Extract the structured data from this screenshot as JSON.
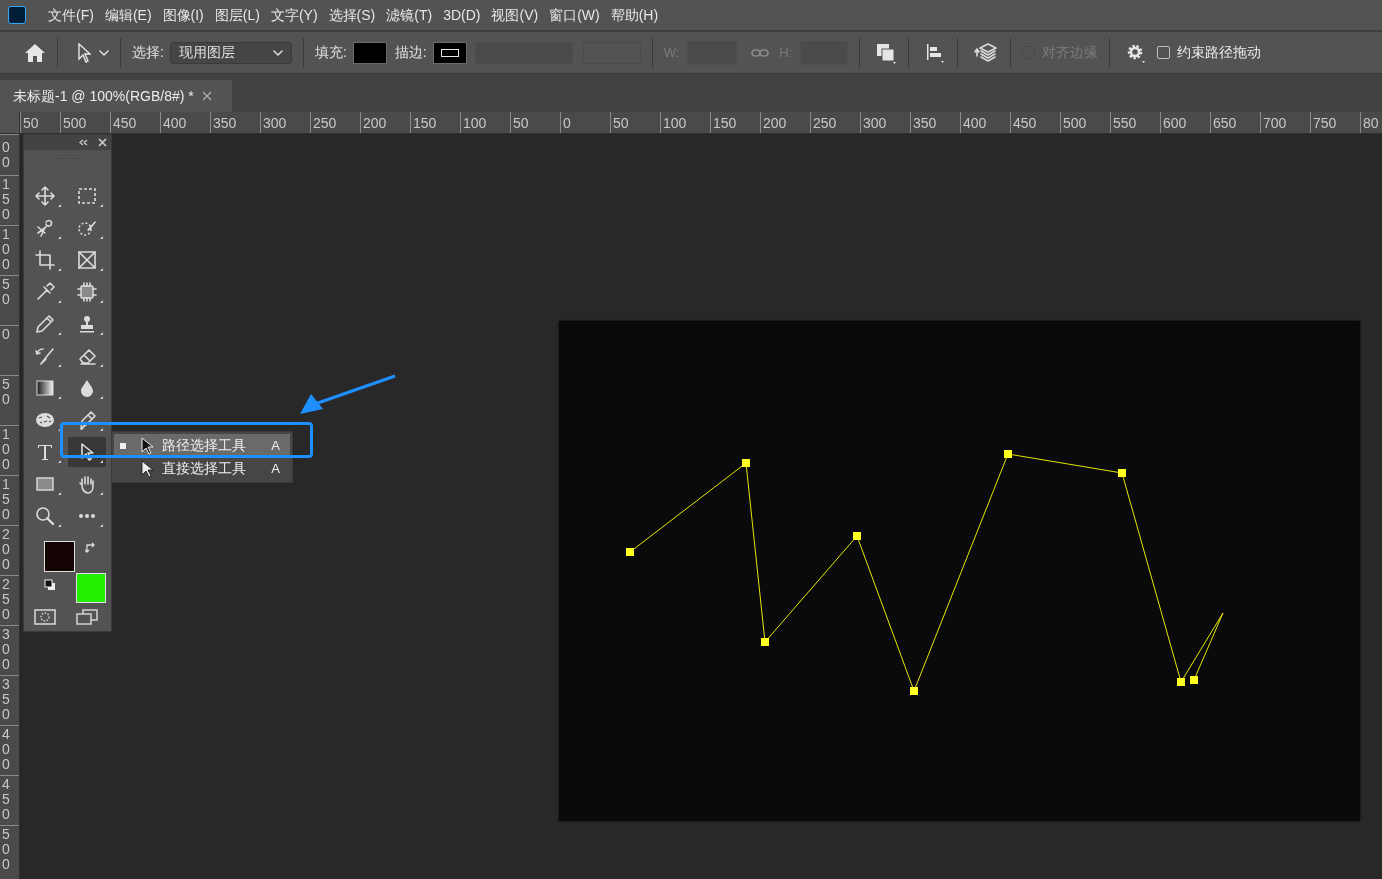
{
  "menu_bar": {
    "items": [
      "文件(F)",
      "编辑(E)",
      "图像(I)",
      "图层(L)",
      "文字(Y)",
      "选择(S)",
      "滤镜(T)",
      "3D(D)",
      "视图(V)",
      "窗口(W)",
      "帮助(H)"
    ]
  },
  "options_bar": {
    "select_label": "选择:",
    "select_value": "现用图层",
    "fill_label": "填充:",
    "stroke_label": "描边:",
    "w_label": "W:",
    "h_label": "H:",
    "align_edges": {
      "label": "对齐边缘",
      "checked": false,
      "disabled": true
    },
    "constrain": {
      "label": "约束路径拖动",
      "checked": false,
      "disabled": false
    }
  },
  "document_tab": {
    "title": "未标题-1 @ 100%(RGB/8#) *",
    "selected": true
  },
  "rulers": {
    "horizontal": [
      "50",
      "500",
      "450",
      "400",
      "350",
      "300",
      "250",
      "200",
      "150",
      "100",
      "50",
      "0",
      "50",
      "100",
      "150",
      "200",
      "250",
      "300",
      "350",
      "400",
      "450",
      "500",
      "550",
      "600",
      "650",
      "700",
      "750",
      "80"
    ],
    "vertical": [
      "00",
      "150",
      "100",
      "50",
      "0",
      "50",
      "100",
      "150",
      "200",
      "250",
      "300",
      "350",
      "400",
      "450",
      "500"
    ]
  },
  "toolbox": {
    "tools": [
      {
        "kind": "move",
        "selected": false
      },
      {
        "kind": "marquee",
        "selected": false
      },
      {
        "kind": "lasso",
        "selected": false
      },
      {
        "kind": "quick_select",
        "selected": false
      },
      {
        "kind": "crop",
        "selected": false
      },
      {
        "kind": "frame",
        "selected": false
      },
      {
        "kind": "eyedropper",
        "selected": false
      },
      {
        "kind": "patch",
        "selected": false
      },
      {
        "kind": "pencil",
        "selected": false
      },
      {
        "kind": "stamp",
        "selected": false
      },
      {
        "kind": "history_brush",
        "selected": false
      },
      {
        "kind": "eraser",
        "selected": false
      },
      {
        "kind": "gradient",
        "selected": false
      },
      {
        "kind": "blur",
        "selected": false
      },
      {
        "kind": "sponge",
        "selected": false
      },
      {
        "kind": "pen",
        "selected": false
      },
      {
        "kind": "type",
        "selected": false
      },
      {
        "kind": "path_select",
        "selected": true
      },
      {
        "kind": "rectangle",
        "selected": false
      },
      {
        "kind": "hand",
        "selected": false
      },
      {
        "kind": "zoom",
        "selected": false
      },
      {
        "kind": "more",
        "selected": false
      }
    ],
    "swatches": [
      {
        "kind": "foreground",
        "color": "#140303"
      },
      {
        "kind": "background",
        "color": "#22f000"
      }
    ]
  },
  "flyout": {
    "items": [
      {
        "label": "路径选择工具",
        "shortcut": "A",
        "selected": true
      },
      {
        "label": "直接选择工具",
        "shortcut": "A",
        "selected": false
      }
    ]
  }
}
